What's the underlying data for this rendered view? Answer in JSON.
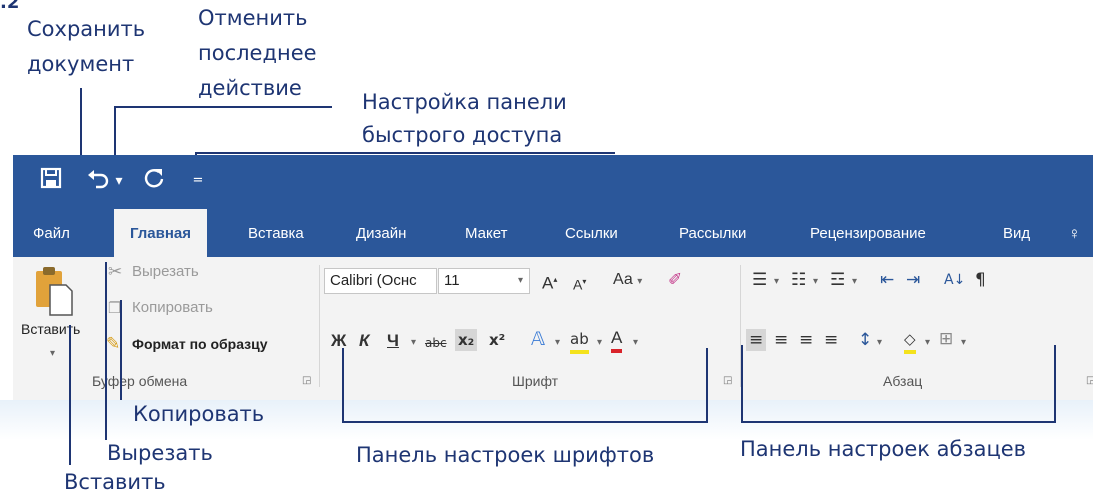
{
  "figure_number": ".2",
  "annotations": {
    "save_document": [
      "Сохранить",
      "документ"
    ],
    "undo_last": [
      "Отменить",
      "последнее",
      "действие"
    ],
    "qat_customize": [
      "Настройка панели",
      "быстрого доступа"
    ],
    "copy": "Копировать",
    "cut": "Вырезать",
    "paste": "Вставить",
    "font_panel": "Панель настроек шрифтов",
    "paragraph_panel": "Панель настроек абзацев"
  },
  "quick_access": {
    "save_icon": "save-icon",
    "undo_icon": "undo-icon",
    "redo_icon": "redo-icon",
    "customize_icon": "customize-qat-icon"
  },
  "tabs": [
    "Файл",
    "Главная",
    "Вставка",
    "Дизайн",
    "Макет",
    "Ссылки",
    "Рассылки",
    "Рецензирование",
    "Вид"
  ],
  "active_tab": "Главная",
  "clipboard": {
    "paste_label": "Вставить",
    "cut_label": "Вырезать",
    "copy_label": "Копировать",
    "format_painter_label": "Формат по образцу",
    "group_label": "Буфер обмена"
  },
  "font": {
    "font_name": "Calibri (Оснс",
    "font_size": "11",
    "bold": "Ж",
    "italic": "К",
    "underline": "Ч",
    "strike": "abc",
    "subscript": "x₂",
    "superscript": "x²",
    "change_case": "Аа",
    "group_label": "Шрифт"
  },
  "paragraph": {
    "group_label": "Абзац"
  },
  "colors": {
    "ribbon_blue": "#2b579a",
    "annotation": "#1e3573",
    "ribbon_bg": "#f3f3f3",
    "highlight_yellow": "#f4e21c",
    "font_color_red": "#d9232a"
  }
}
